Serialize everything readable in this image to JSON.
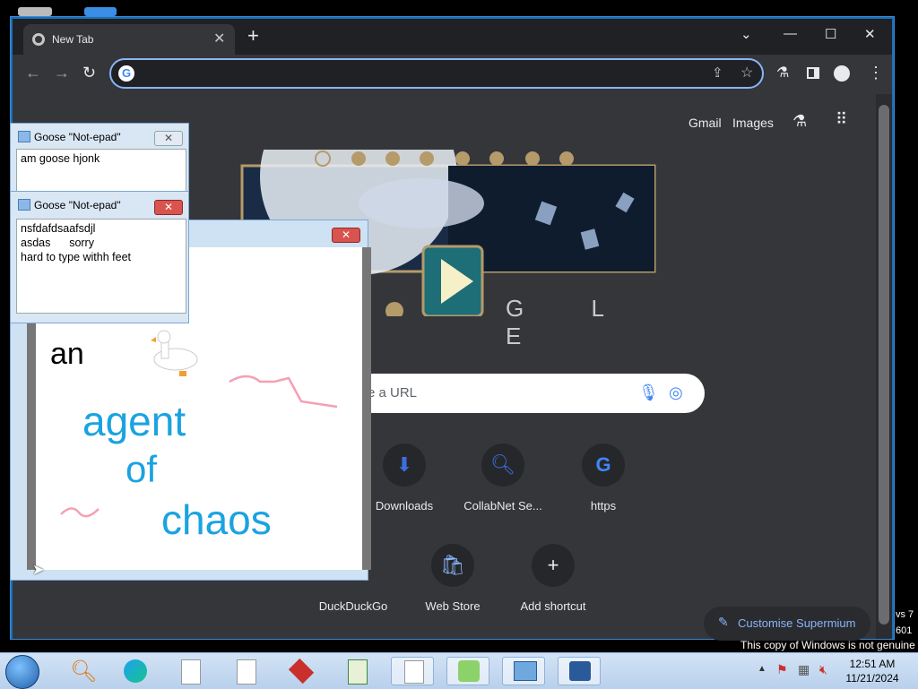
{
  "browser": {
    "tab_title": "New Tab",
    "omnibox_value": "",
    "top_links": {
      "gmail": "Gmail",
      "images": "Images"
    },
    "doodle_letters": "G L E",
    "search_placeholder": "e a URL",
    "shortcuts": [
      {
        "label": "Downloads"
      },
      {
        "label": "CollabNet Se..."
      },
      {
        "label": "https"
      },
      {
        "label": "DuckDuckGo"
      },
      {
        "label": "Web Store"
      },
      {
        "label": "Add shortcut"
      }
    ],
    "customise_label": "Customise Supermium"
  },
  "notepad_back": {
    "title": "Goose \"Not-epad\"",
    "text": "am goose hjonk"
  },
  "notepad_front": {
    "title": "Goose \"Not-epad\"",
    "text": "nsfdafdsaafsdjl\nasdas      sorry\nhard to type withh feet"
  },
  "paint": {
    "words": [
      "an",
      "agent",
      "of",
      "chaos"
    ]
  },
  "desktop": {
    "side_text_1": "vs 7",
    "side_text_2": "601",
    "genuine_notice": "This copy of Windows is not genuine"
  },
  "taskbar": {
    "time": "12:51 AM",
    "date": "11/21/2024"
  }
}
